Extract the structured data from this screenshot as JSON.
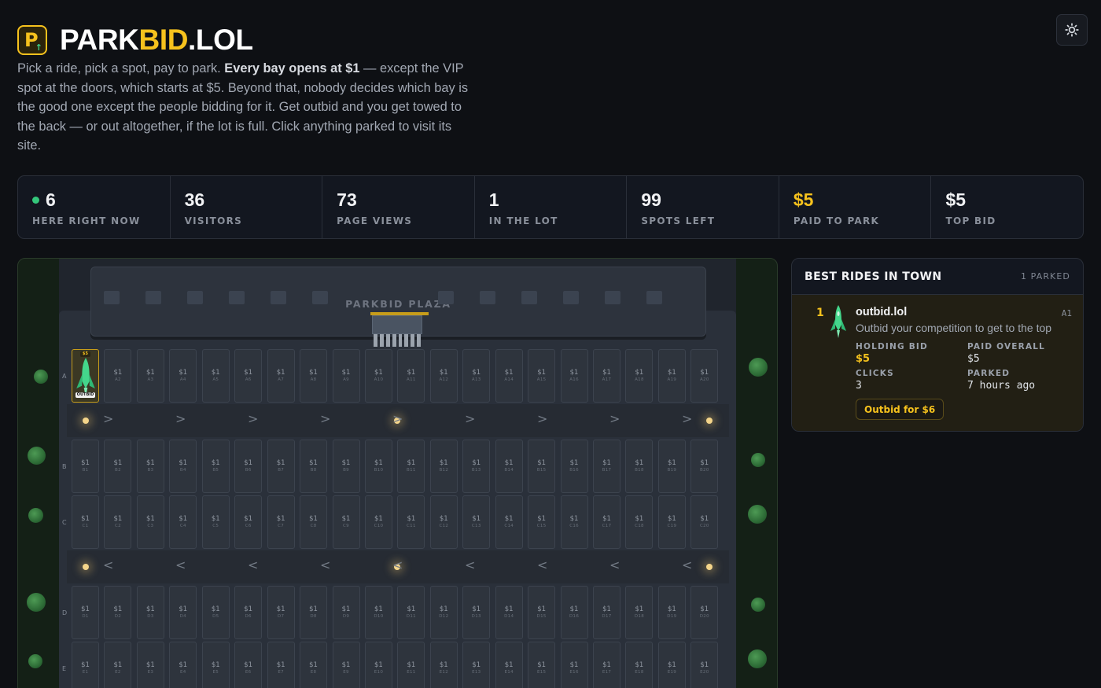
{
  "site": {
    "brand_main": "PARK",
    "brand_accent": "BID",
    "brand_suffix": ".LOL",
    "logo_letter": "P",
    "logo_arrow": "↑"
  },
  "intro": {
    "lead": "Pick a ride, pick a spot, pay to park. ",
    "bold": "Every bay opens at $1",
    "rest": " — except the VIP spot at the doors, which starts at $5. Beyond that, nobody decides which bay is the good one except the people bidding for it. Get outbid and you get towed to the back — or out altogether, if the lot is full. Click anything parked to visit its site."
  },
  "stats": [
    {
      "value": "6",
      "label": "HERE RIGHT NOW",
      "live": true
    },
    {
      "value": "36",
      "label": "VISITORS"
    },
    {
      "value": "73",
      "label": "PAGE VIEWS"
    },
    {
      "value": "1",
      "label": "IN THE LOT"
    },
    {
      "value": "99",
      "label": "SPOTS LEFT"
    },
    {
      "value": "$5",
      "label": "PAID TO PARK",
      "highlight": true
    },
    {
      "value": "$5",
      "label": "TOP BID"
    }
  ],
  "lot": {
    "building_name": "PARKBID PLAZA",
    "rows": [
      {
        "letter": "A",
        "bays": 20
      },
      {
        "letter": "B",
        "bays": 20
      },
      {
        "letter": "C",
        "bays": 20
      },
      {
        "letter": "D",
        "bays": 20
      },
      {
        "letter": "E",
        "bays": 20
      }
    ],
    "bay_price": "$1",
    "occupied": {
      "row": "A",
      "bay": 1,
      "price": "$5",
      "tag": "OUTBID"
    },
    "lane_arrows": [
      ">",
      "<"
    ]
  },
  "leaderboard": {
    "title": "BEST RIDES IN TOWN",
    "count": "1 PARKED",
    "entries": [
      {
        "rank": "1",
        "site": "outbid.lol",
        "spot": "A1",
        "tagline": "Outbid your competition to get to the top",
        "holding_bid_label": "HOLDING BID",
        "holding_bid": "$5",
        "paid_overall_label": "PAID OVERALL",
        "paid_overall": "$5",
        "clicks_label": "CLICKS",
        "clicks": "3",
        "parked_label": "PARKED",
        "parked": "7 hours ago",
        "action": "Outbid for $6"
      }
    ]
  },
  "colors": {
    "background": "#0e1014",
    "accent": "#f6c21d",
    "live": "#34c77b",
    "grass": "#142016",
    "asphalt": "#2a303a"
  },
  "icons": {
    "theme_toggle": "sun-icon",
    "vehicle": "rocket-icon"
  }
}
